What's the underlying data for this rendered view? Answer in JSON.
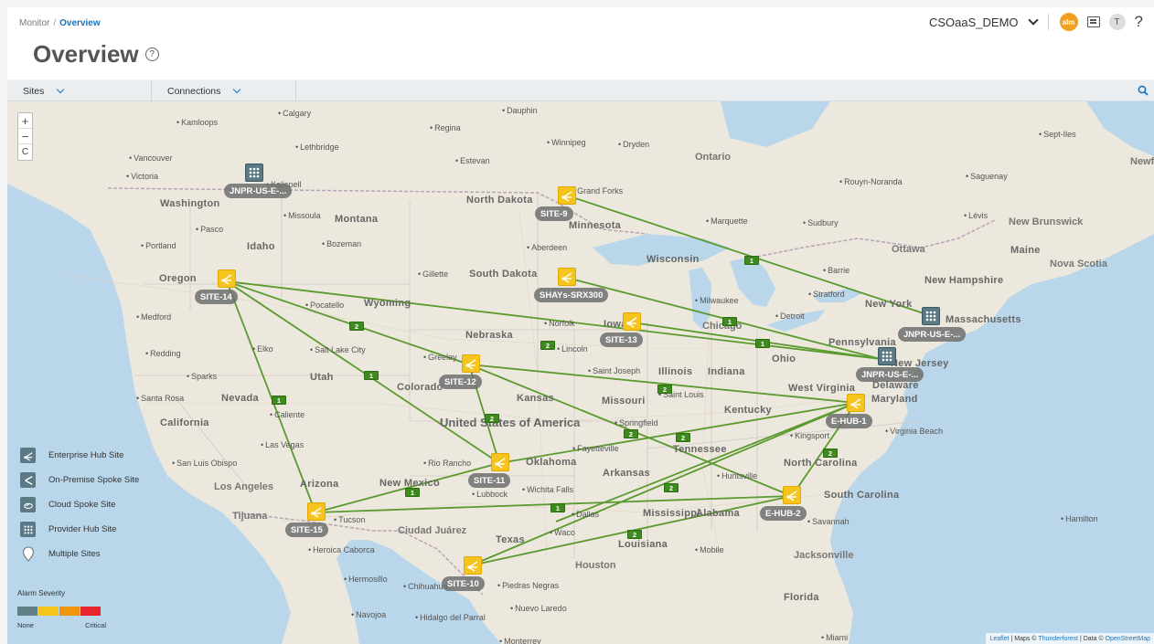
{
  "breadcrumb": {
    "root": "Monitor",
    "separator": "/",
    "current": "Overview"
  },
  "page": {
    "title": "Overview",
    "help_glyph": "?"
  },
  "header": {
    "tenant": "CSOaaS_DEMO",
    "alarm_badge": "alm",
    "avatar_initial": "T",
    "help": "?"
  },
  "filters": {
    "sites_label": "Sites",
    "connections_label": "Connections"
  },
  "map": {
    "zoom_in": "+",
    "zoom_out": "−",
    "reset": "C",
    "attribution": {
      "leaflet": "Leaflet",
      "maps": "Maps ©",
      "thunderforest": "Thunderforest",
      "data": "Data ©",
      "osm": "OpenStreetMap"
    },
    "labels": [
      "Calgary",
      "Kamloops",
      "Lethbridge",
      "Regina",
      "Winnipeg",
      "Dryden",
      "Estevan",
      "Dauphin",
      "Vancouver",
      "Victoria",
      "Kalispell",
      "Missoula",
      "Washington",
      "Montana",
      "Pasco",
      "Bozeman",
      "Portland",
      "Idaho",
      "Oregon",
      "Medford",
      "Redding",
      "Sparks",
      "Santa Rosa",
      "Nevada",
      "California",
      "Pocatello",
      "Wyoming",
      "Salt Lake City",
      "Utah",
      "Elko",
      "Caliente",
      "Las Vegas",
      "San Luis Obispo",
      "Los Angeles",
      "Tijuana",
      "Arizona",
      "Tucson",
      "Heroica Caborca",
      "Hermosillo",
      "Navojoa",
      "Hidalgo del Parral",
      "Chihuahua",
      "Ciudad Juárez",
      "New Mexico",
      "Rio Rancho",
      "Lubbock",
      "Texas",
      "Piedras Negras",
      "Nuevo Laredo",
      "Monterrey",
      "Houston",
      "Waco",
      "Dallas",
      "Wichita Falls",
      "Oklahoma",
      "Kansas",
      "Colorado",
      "Greeley",
      "Nebraska",
      "Lincoln",
      "Norfolk",
      "South Dakota",
      "North Dakota",
      "Gillette",
      "Aberdeen",
      "Grand Forks",
      "Minnesota",
      "Wisconsin",
      "Marquette",
      "Ontario",
      "Sudbury",
      "Rouyn-Noranda",
      "Saguenay",
      "Sept-Iles",
      "Lévis",
      "New Brunswick",
      "Ottawa",
      "Maine",
      "Nova Scotia",
      "New Hampshire",
      "Barrie",
      "Stratford",
      "Detroit",
      "Milwaukee",
      "Chicago",
      "Iowa",
      "Illinois",
      "Indiana",
      "Ohio",
      "Pennsylvania",
      "New York",
      "Massachusetts",
      "New Jersey",
      "Delaware",
      "Maryland",
      "West Virginia",
      "Kentucky",
      "Tennessee",
      "Virginia Beach",
      "Kingsport",
      "North Carolina",
      "South Carolina",
      "Savannah",
      "Jacksonville",
      "Florida",
      "Miami",
      "Mobile",
      "Louisiana",
      "Mississippi",
      "Alabama",
      "Arkansas",
      "Huntsville",
      "Fayetteville",
      "Springfield",
      "Missouri",
      "Saint Joseph",
      "Saint Louis",
      "Hamilton",
      "United States of America",
      "Newf"
    ]
  },
  "sites": [
    {
      "name": "JNPR-US-E-...",
      "type": "provider-hub"
    },
    {
      "name": "SITE-9",
      "type": "spoke"
    },
    {
      "name": "SITE-14",
      "type": "spoke"
    },
    {
      "name": "SHAYs-SRX300",
      "type": "spoke"
    },
    {
      "name": "SITE-13",
      "type": "spoke"
    },
    {
      "name": "JNPR-US-E-...",
      "type": "provider-hub"
    },
    {
      "name": "JNPR-US-E-...",
      "type": "provider-hub"
    },
    {
      "name": "SITE-12",
      "type": "spoke"
    },
    {
      "name": "E-HUB-1",
      "type": "hub"
    },
    {
      "name": "SITE-11",
      "type": "spoke"
    },
    {
      "name": "E-HUB-2",
      "type": "hub"
    },
    {
      "name": "SITE-15",
      "type": "spoke"
    },
    {
      "name": "SITE-10",
      "type": "spoke"
    }
  ],
  "connection_counts": [
    "1",
    "1",
    "1",
    "2",
    "2",
    "1",
    "1",
    "1",
    "2",
    "2",
    "2",
    "2",
    "2",
    "2",
    "1",
    "2",
    "2",
    "2",
    "2"
  ],
  "legend": {
    "items": [
      "Enterprise Hub Site",
      "On-Premise Spoke Site",
      "Cloud Spoke Site",
      "Provider Hub Site",
      "Multiple Sites"
    ],
    "severity_title": "Alarm Severity",
    "severity_min": "None",
    "severity_max": "Critical",
    "severity_colors": [
      "#5f7f86",
      "#f5c51e",
      "#f0960e",
      "#e8252e"
    ]
  },
  "colors": {
    "link": "#5a9a2e",
    "accent": "#1a73b8",
    "spoke": "#f5c51e",
    "provider": "#5c7a86"
  }
}
